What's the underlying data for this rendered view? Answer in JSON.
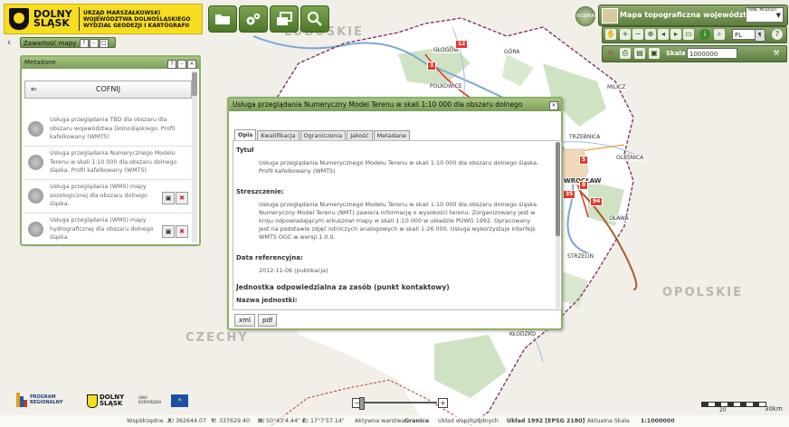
{
  "header": {
    "logo_name": "DOLNY ŚLĄSK",
    "institution": "URZĄD MARSZAŁKOWSKI WOJEWÓDZTWA DOLNOŚLĄSKIEGO WYDZIAŁ GEODEZJI I KARTOGRAFII",
    "tools": [
      {
        "name": "folder-icon"
      },
      {
        "name": "gears-icon"
      },
      {
        "name": "windows-icon"
      },
      {
        "name": "search-icon"
      }
    ]
  },
  "map_selector": {
    "home_label": "ROZMIAR",
    "title": "Mapa topograficzna województwa",
    "other_label": "INNE MODUŁY"
  },
  "toolbar": {
    "language": "PL",
    "scale_label": "Skala",
    "scale_value": "1000000"
  },
  "content_tab": {
    "label": "Zawartość mapy",
    "help": "?",
    "min": "–",
    "close": "□"
  },
  "metadata_panel": {
    "title": "Metadane",
    "back_label": "COFNIJ",
    "items": [
      {
        "text": "Usługa przeglądania TBD dla obszaru dla obszaru województwa Dolnośląskiego. Profil kafelkowany (WMTS)"
      },
      {
        "text": "Usługa przeglądania Numerycznego Modelu Terenu w skali 1:10 000 dla obszaru dolnego śląska. Profil kafelkowany (WMTS)"
      },
      {
        "text": "Usługa przeglądania (WMS) mapy sozologicznej dla obszaru dolnego śląska."
      },
      {
        "text": "Usługa przeglądania (WMS) mapy hydrograficznej dla obszaru dolnego śląska"
      }
    ]
  },
  "dialog": {
    "title": "Usługa przeglądania Numeryczny Model Terenu w skali 1:10 000 dla obszaru dolnego",
    "tabs": [
      "Opis",
      "Kwalifikacja",
      "Ograniczenia",
      "Jakość",
      "Metadane"
    ],
    "tytul_label": "Tytuł",
    "tytul_text": "Usługa przeglądania Numerycznego Modelu Terenu w skali 1:10 000 dla obszaru dolnego śląska. Profil kafelkowany (WMTS)",
    "streszczenie_label": "Streszczenie:",
    "streszczenie_text": "Usługa przeglądania Numerycznego Modelu Terenu w skali 1:10 000 dla obszaru dolnego śląska. Numeryczny Model Terenu (NMT) zawiera informację o wysokości terenu. Zorganizowany jest w kroju odpowiadającym arkuszowi mapy w skali 1:10 000 w układzie PUWG 1992. Opracowany jest na podstawie zdjęć lotniczych analogowych w skali 1:26 000. Usługa wykorzystuje interfejs WMTS OGC w wersji 1.0.0.",
    "data_label": "Data referencyjna:",
    "data_text": "2012-11-06 (publikacja)",
    "jednostka_label": "Jednostka odpowiedzialna za zasób (punkt kontaktowy)",
    "nazwa_label": "Nazwa jednostki:",
    "xml_btn": "xml",
    "pdf_btn": "pdf"
  },
  "map": {
    "regions": [
      "LUBUSKIE",
      "OPOLSKIE",
      "CZECHY"
    ],
    "cities": [
      "GŁOGÓW",
      "GÓRA",
      "POLKOWICE",
      "MILICZ",
      "TRZEBNICA",
      "OLEŚNICA",
      "WROCŁAW",
      "OŁAWA",
      "STRZELIN",
      "KŁODZKO"
    ],
    "road_numbers": [
      "12",
      "3",
      "5",
      "8",
      "35",
      "94"
    ]
  },
  "footer": {
    "logo1": "PROGRAM REGIONALNY",
    "logo2": "DOLNY ŚLĄSK",
    "logo3": "UNIA EUROPEJSKA",
    "scale_text": "30km",
    "scale_small": "20",
    "status": {
      "coord_label": "Współrzędne",
      "x_label": "X:",
      "x": "362644.07",
      "y_label": "Y:",
      "y": "337629.40",
      "n_label": "N:",
      "n": "50°43'4.44\"",
      "e_label": "E:",
      "e": "17°7'57.14\"",
      "layer_label": "Aktywna warstwa",
      "layer": "Granice",
      "crs_label": "Układ współrzędnych",
      "crs": "Układ 1992 [EPSG 2180]",
      "scale_label": "Aktualna Skala",
      "scale": "1:1000000"
    }
  },
  "colors": {
    "accent": "#6f9048",
    "logo_yellow": "#f7dd1f",
    "river": "#7aa7d8",
    "road": "#e03b2e",
    "voiv_border": "#7b2a60"
  }
}
